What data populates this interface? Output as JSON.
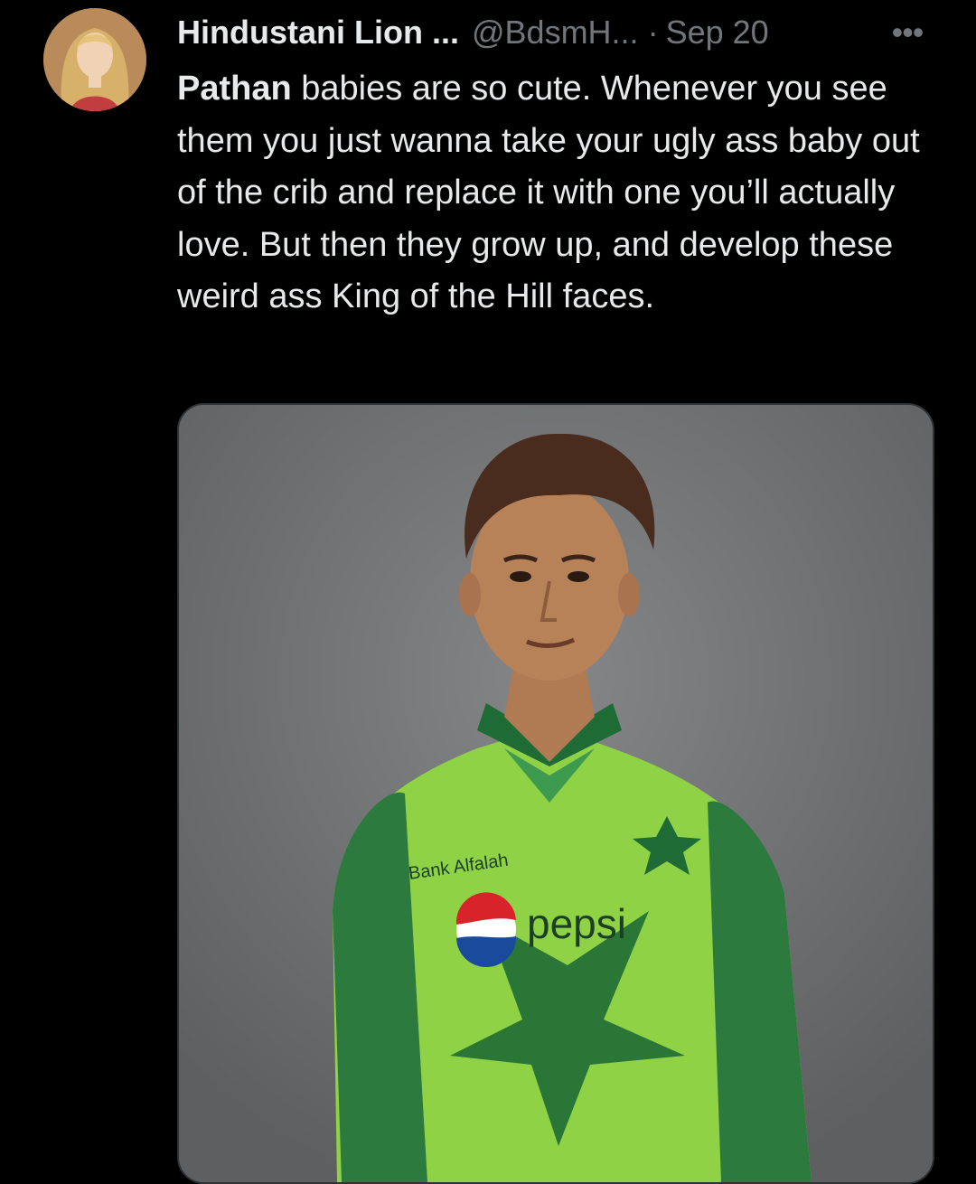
{
  "tweet": {
    "author_name": "Hindustani Lion ...",
    "author_handle": "@BdsmH...",
    "separator": "·",
    "date": "Sep 20",
    "more_label": "•••",
    "text_bold": "Pathan",
    "text_rest": " babies are so cute. Whenever you see them you just wanna take your ugly ass baby out of the crib and replace it with one you’ll actually love. But then they grow up, and develop these weird ass King of the Hill faces."
  },
  "media": {
    "sponsor_text": "Bank Alfalah",
    "brand_text": "pepsi",
    "colors": {
      "background": "#6e6f70",
      "jersey": "#8fd246",
      "jersey_dark": "#1f6b35"
    }
  },
  "colors": {
    "page_background": "#000000",
    "primary_text": "#e7e9ea",
    "secondary_text": "#71767b",
    "border": "#2f3336"
  }
}
